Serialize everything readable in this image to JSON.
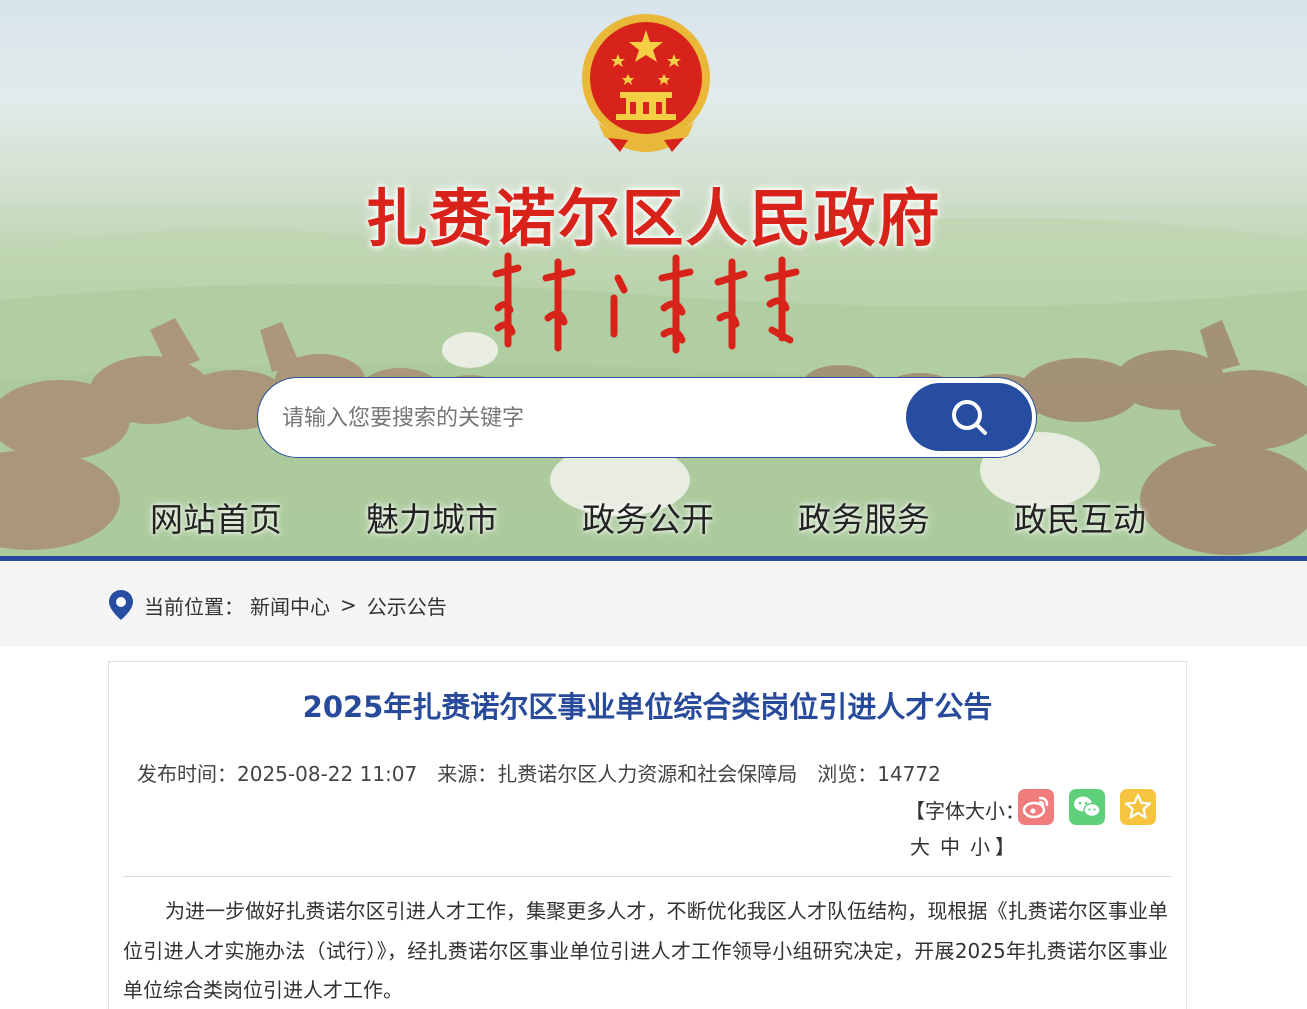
{
  "header": {
    "site_title": "扎赉诺尔区人民政府",
    "emblem_name": "national-emblem",
    "mongolian_script_name": "mongolian-script-title"
  },
  "search": {
    "placeholder": "请输入您要搜索的关键字",
    "button_icon": "search-icon"
  },
  "nav": {
    "items": [
      {
        "label": "网站首页"
      },
      {
        "label": "魅力城市"
      },
      {
        "label": "政务公开"
      },
      {
        "label": "政务服务"
      },
      {
        "label": "政民互动"
      }
    ]
  },
  "breadcrumb": {
    "icon": "location-pin-icon",
    "prefix": "当前位置：",
    "items": [
      "新闻中心",
      "公示公告"
    ],
    "separator": ">"
  },
  "article": {
    "title": "2025年扎赉诺尔区事业单位综合类岗位引进人才公告",
    "publish_label": "发布时间：",
    "publish_time": "2025-08-22 11:07",
    "source_label": "来源：",
    "source": "扎赉诺尔区人力资源和社会保障局",
    "views_label": "浏览：",
    "views": "14772",
    "font_size_open": "【字体大小：",
    "font_size_large": "大",
    "font_size_medium": "中",
    "font_size_small": "小",
    "font_size_close": "】",
    "share_icons": [
      "weibo-icon",
      "wechat-icon",
      "favorite-star-icon"
    ],
    "body_paragraph": "为进一步做好扎赉诺尔区引进人才工作，集聚更多人才，不断优化我区人才队伍结构，现根据《扎赉诺尔区事业单位引进人才实施办法（试行）》，经扎赉诺尔区事业单位引进人才工作领导小组研究决定，开展2025年扎赉诺尔区事业单位综合类岗位引进人才工作。"
  },
  "colors": {
    "brand_blue": "#264da0",
    "title_red": "#d8231b",
    "article_title_blue": "#284a9a"
  }
}
